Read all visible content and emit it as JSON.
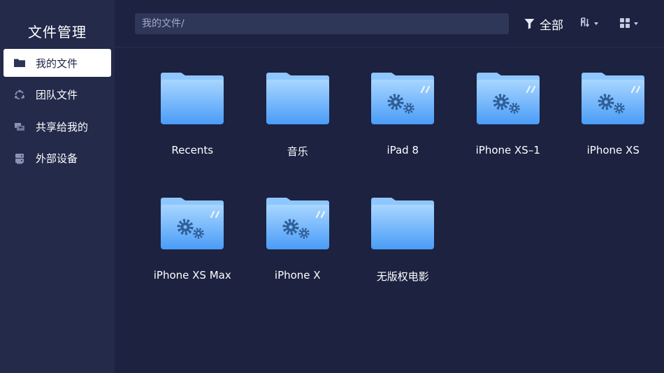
{
  "sidebar": {
    "title": "文件管理",
    "items": [
      {
        "label": "我的文件",
        "icon": "folder-icon",
        "active": true
      },
      {
        "label": "团队文件",
        "icon": "team-icon",
        "active": false
      },
      {
        "label": "共享给我的",
        "icon": "shared-icon",
        "active": false
      },
      {
        "label": "外部设备",
        "icon": "device-icon",
        "active": false
      }
    ]
  },
  "topbar": {
    "path": "我的文件/",
    "filter_label": "全部",
    "filter_icon": "filter-icon",
    "sort_icon": "sort-icon",
    "view_icon": "grid-view-icon"
  },
  "files": [
    {
      "name": "Recents",
      "type": "folder"
    },
    {
      "name": "音乐",
      "type": "folder"
    },
    {
      "name": "iPad 8",
      "type": "device-folder"
    },
    {
      "name": "iPhone XS–1",
      "type": "device-folder"
    },
    {
      "name": "iPhone XS",
      "type": "device-folder"
    },
    {
      "name": "iPhone XS Max",
      "type": "device-folder"
    },
    {
      "name": "iPhone X",
      "type": "device-folder"
    },
    {
      "name": "无版权电影",
      "type": "folder"
    }
  ],
  "colors": {
    "background": "#1c2240",
    "sidebar": "#232a4a",
    "folder_light": "#a8d6ff",
    "folder_dark": "#4a9cf7"
  }
}
